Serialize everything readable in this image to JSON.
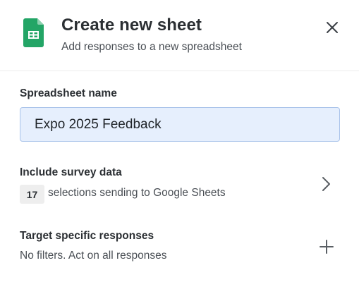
{
  "header": {
    "title": "Create new sheet",
    "subtitle": "Add responses to a new spreadsheet",
    "icon": "google-sheets-icon",
    "close_icon": "close-icon"
  },
  "spreadsheet_name": {
    "label": "Spreadsheet name",
    "value": "Expo 2025 Feedback"
  },
  "survey_data": {
    "label": "Include survey data",
    "count": "17",
    "description": "selections sending to Google Sheets",
    "icon": "chevron-right-icon"
  },
  "target_responses": {
    "label": "Target specific responses",
    "description": "No filters. Act on all responses",
    "icon": "plus-icon"
  },
  "colors": {
    "sheets_green": "#23a566",
    "input_background": "#e6effd",
    "input_border": "#a9c3ea",
    "badge_background": "#eeeeee"
  }
}
